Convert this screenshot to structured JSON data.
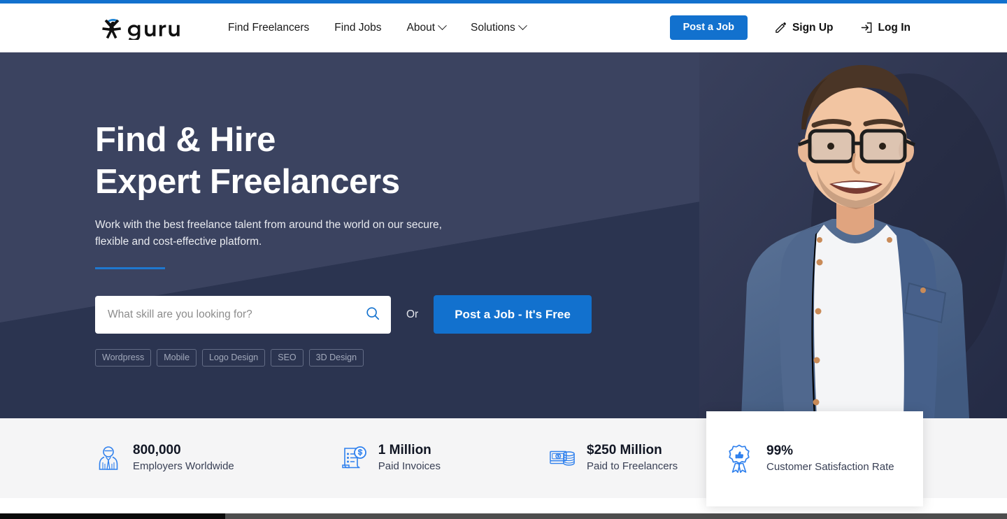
{
  "brand": {
    "name": "guru",
    "logo_icon": "guru-stickman-logo"
  },
  "header": {
    "nav": [
      {
        "label": "Find Freelancers",
        "has_caret": false
      },
      {
        "label": "Find Jobs",
        "has_caret": false
      },
      {
        "label": "About",
        "has_caret": true
      },
      {
        "label": "Solutions",
        "has_caret": true
      }
    ],
    "post_job_button": "Post a Job",
    "sign_up": {
      "label": "Sign Up",
      "icon": "pencil-edit-icon"
    },
    "log_in": {
      "label": "Log In",
      "icon": "login-arrow-icon"
    },
    "accent_color": "#1271ce"
  },
  "hero": {
    "heading_line1": "Find & Hire",
    "heading_line2": "Expert Freelancers",
    "subheading": "Work with the best freelance talent from around the world on our secure, flexible and cost-effective platform.",
    "background_color": "#2b3450",
    "band_color": "#3b4360",
    "accent_line_color": "#1f78cf",
    "search": {
      "placeholder": "What skill are you looking for?",
      "value": "",
      "icon": "search-icon"
    },
    "or_label": "Or",
    "cta_button": "Post a Job - It's Free",
    "tags": [
      "Wordpress",
      "Mobile",
      "Logo Design",
      "SEO",
      "3D Design"
    ],
    "photo_alt": "smiling-man-with-glasses-denim-shirt"
  },
  "stats": [
    {
      "number": "800,000",
      "label": "Employers Worldwide",
      "icon": "employer-person-icon"
    },
    {
      "number": "1 Million",
      "label": "Paid Invoices",
      "icon": "invoice-dollar-icon"
    },
    {
      "number": "$250 Million",
      "label": "Paid to Freelancers",
      "icon": "cash-coins-icon"
    }
  ],
  "floating_card": {
    "number": "99%",
    "label": "Customer Satisfaction Rate",
    "icon": "award-ribbon-thumbsup-icon"
  },
  "colors": {
    "brand_blue": "#1271ce",
    "icon_blue": "#2f80ed",
    "hero_navy": "#2b3450",
    "stats_band": "#f5f5f6"
  }
}
